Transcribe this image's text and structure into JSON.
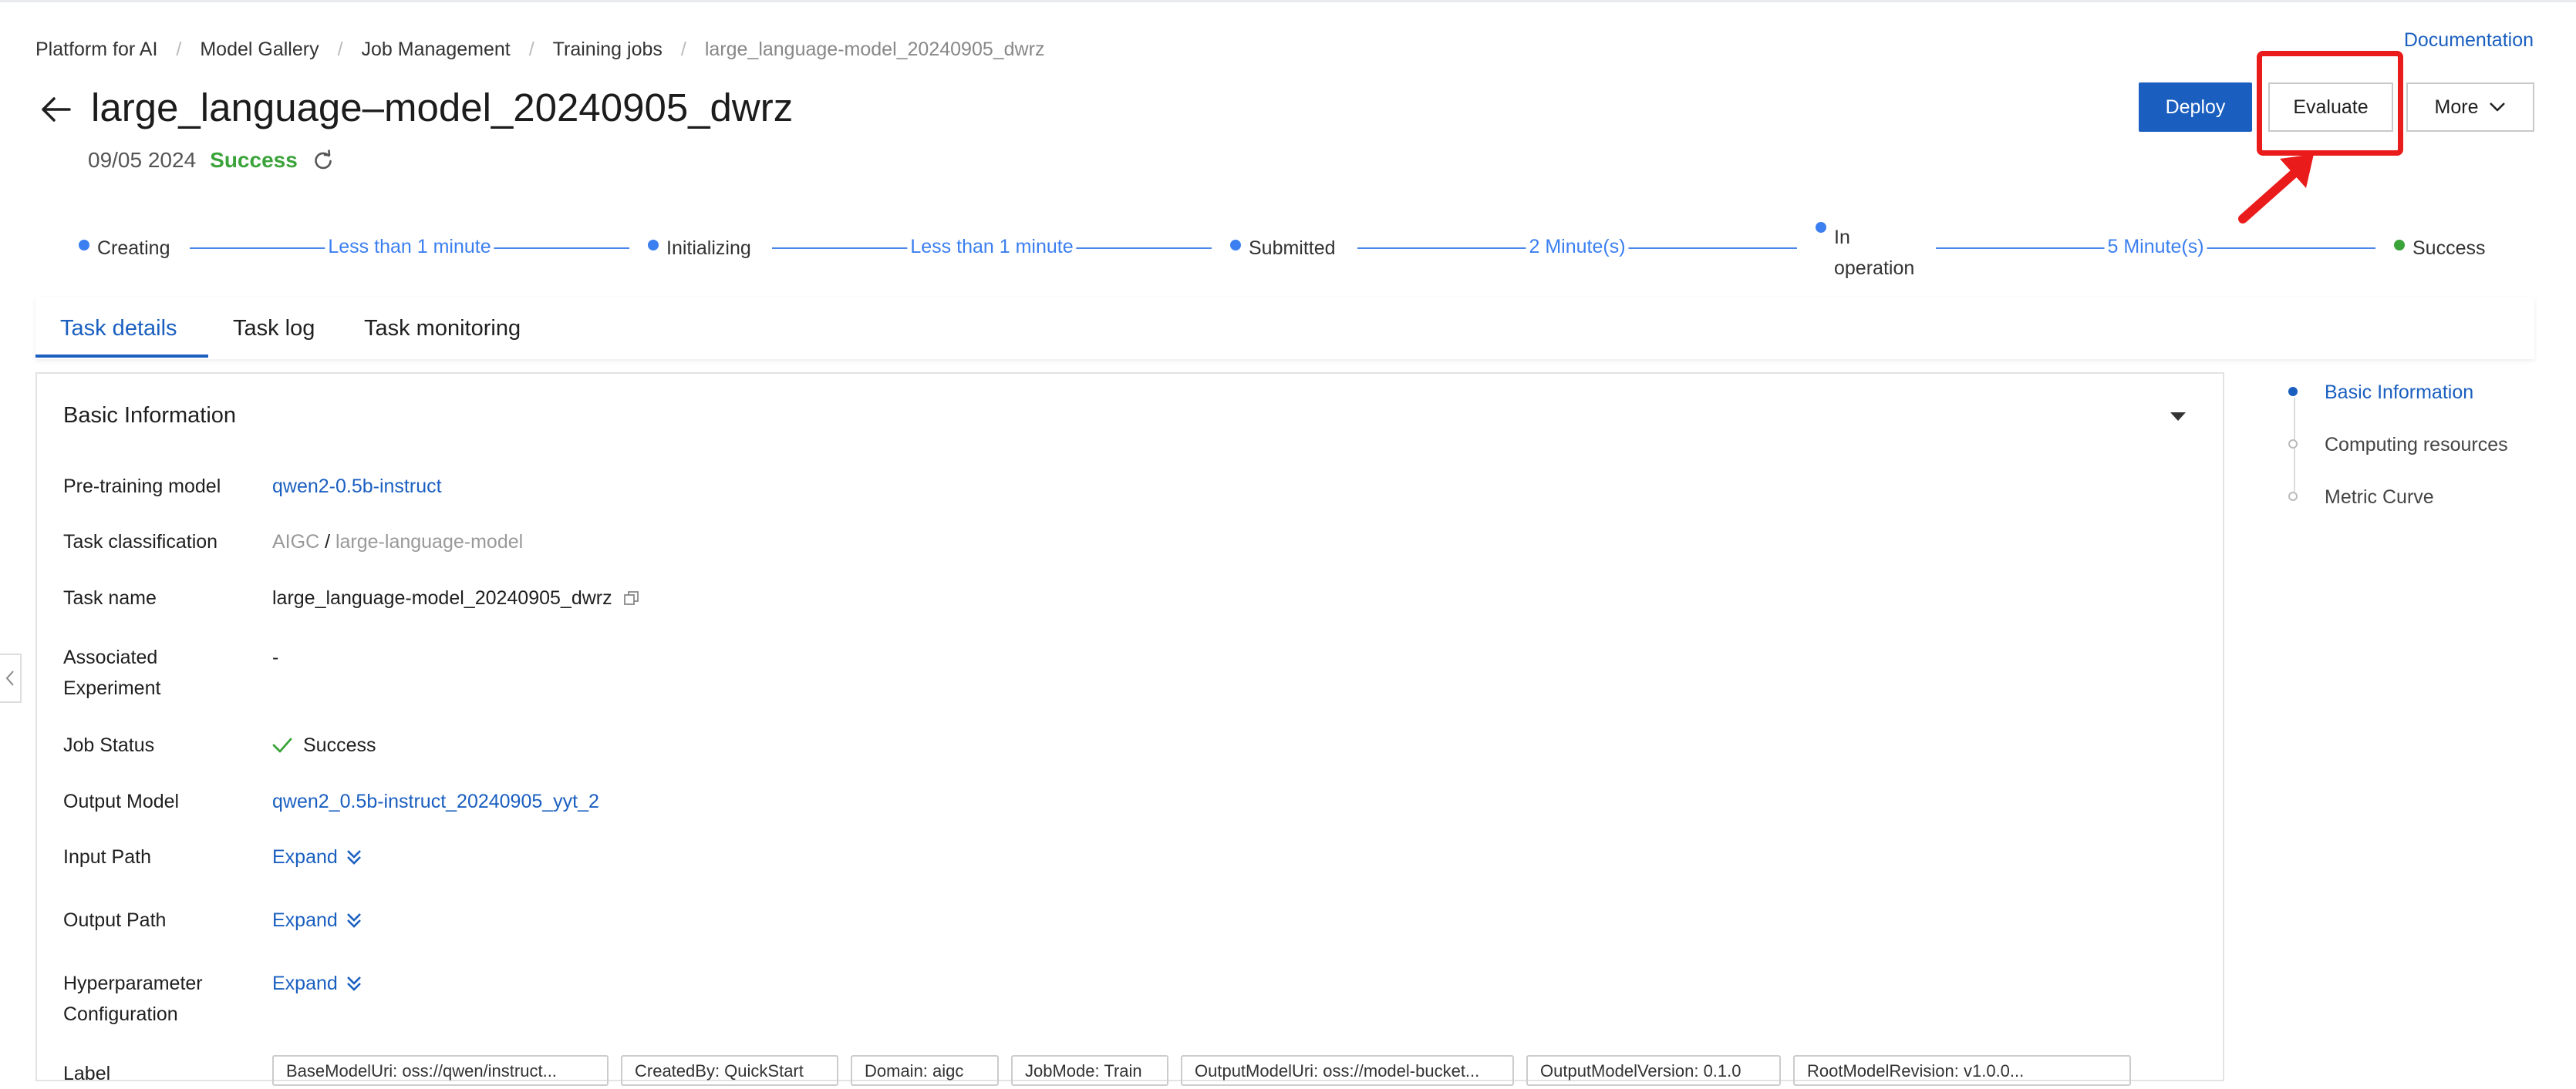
{
  "breadcrumb": [
    "Platform for AI",
    "Model Gallery",
    "Job Management",
    "Training jobs",
    "large_language-model_20240905_dwrz"
  ],
  "documentation_label": "Documentation",
  "header": {
    "title": "large_language–model_20240905_dwrz",
    "date": "09/05 2024",
    "status": "Success"
  },
  "actions": {
    "deploy": "Deploy",
    "evaluate": "Evaluate",
    "more": "More"
  },
  "progress": {
    "steps": [
      "Creating",
      "Initializing",
      "Submitted",
      "In operation",
      "Success"
    ],
    "durations": [
      "Less than 1 minute",
      "Less than 1 minute",
      "2 Minute(s)",
      "5 Minute(s)"
    ]
  },
  "tabs": [
    "Task details",
    "Task log",
    "Task monitoring"
  ],
  "basic_info": {
    "title": "Basic Information",
    "rows": {
      "pretrain_label": "Pre-training model",
      "pretrain_value": "qwen2-0.5b-instruct",
      "taskclass_label": "Task classification",
      "taskclass_a": "AIGC",
      "taskclass_sep": " / ",
      "taskclass_b": "large-language-model",
      "taskname_label": "Task name",
      "taskname_value": "large_language-model_20240905_dwrz",
      "assoc_label": "Associated Experiment",
      "assoc_value": "-",
      "jobstatus_label": "Job Status",
      "jobstatus_value": "Success",
      "output_model_label": "Output Model",
      "output_model_value": "qwen2_0.5b-instruct_20240905_yyt_2",
      "input_path_label": "Input Path",
      "output_path_label": "Output Path",
      "hyper_label": "Hyperparameter Configuration",
      "expand": "Expand",
      "label_label": "Label"
    },
    "tags": [
      "BaseModelUri: oss://qwen/instruct...",
      "CreatedBy: QuickStart",
      "Domain: aigc",
      "JobMode: Train",
      "OutputModelUri: oss://model-bucket...",
      "OutputModelVersion: 0.1.0",
      "RootModelRevision: v1.0.0..."
    ]
  },
  "anchors": [
    "Basic Information",
    "Computing resources",
    "Metric Curve"
  ],
  "colors": {
    "primary": "#1a5fc0",
    "success": "#3aa33a",
    "annotation": "#ea1b1b"
  }
}
